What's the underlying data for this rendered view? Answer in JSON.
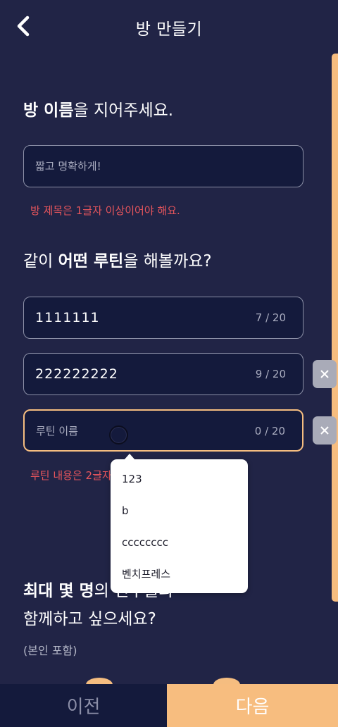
{
  "header": {
    "title": "방 만들기",
    "back_icon": "chevron-left-icon"
  },
  "room_name": {
    "title_bold": "방 이름",
    "title_rest": "을 지어주세요.",
    "placeholder": "짧고 명확하게!",
    "error": "방 제목은 1글자 이상이어야 해요."
  },
  "routine": {
    "title_pre": "같이 ",
    "title_bold1": "어떤 루틴",
    "title_rest": "을 해볼까요?",
    "items": [
      {
        "value": "1111111",
        "count": "7 / 20"
      },
      {
        "value": "222222222",
        "count": "9 / 20"
      },
      {
        "placeholder": "루틴 이름",
        "count": "0 / 20"
      }
    ],
    "error": "루틴 내용은 2글자",
    "delete_icon": "close-icon"
  },
  "dropdown": {
    "options": [
      "123",
      "b",
      "cccccccc",
      "벤치프레스"
    ]
  },
  "members": {
    "title_bold": "최대 몇 명",
    "title_rest": "의 친구들과",
    "line2": "함께하고 싶으세요?",
    "note": "(본인 포함)"
  },
  "footer": {
    "prev": "이전",
    "next": "다음"
  },
  "colors": {
    "accent": "#f7bd7f",
    "background": "#212446",
    "error": "#e6555c",
    "field": "#141a3c"
  }
}
